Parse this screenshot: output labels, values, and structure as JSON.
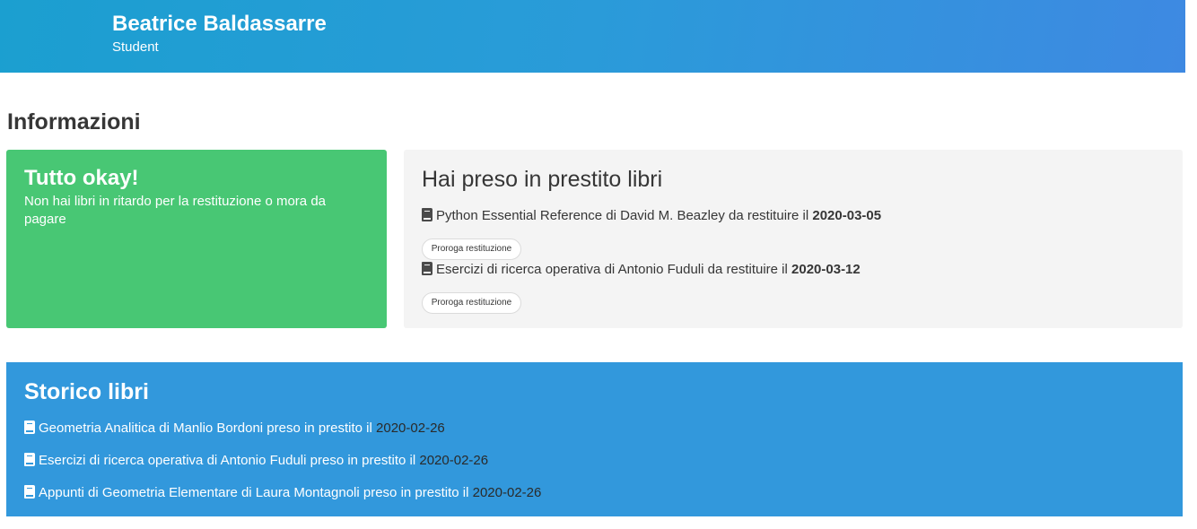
{
  "header": {
    "name": "Beatrice Baldassarre",
    "role": "Student"
  },
  "section_title": "Informazioni",
  "status_card": {
    "title": "Tutto okay!",
    "message": "Non hai libri in ritardo per la restituzione o mora da pagare"
  },
  "loans_card": {
    "title": "Hai preso in prestito libri",
    "items": [
      {
        "icon": "book-icon",
        "text": "Python Essential Reference di David M. Beazley da restituire il ",
        "due": "2020-03-05",
        "button": "Proroga restituzione"
      },
      {
        "icon": "book-icon",
        "text": "Esercizi di ricerca operativa di Antonio Fuduli da restituire il ",
        "due": "2020-03-12",
        "button": "Proroga restituzione"
      }
    ]
  },
  "history_card": {
    "title": "Storico libri",
    "items": [
      {
        "icon": "book-icon",
        "text": "Geometria Analitica di Manlio Bordoni preso in prestito il ",
        "date": "2020-02-26"
      },
      {
        "icon": "book-icon",
        "text": "Esercizi di ricerca operativa di Antonio Fuduli preso in prestito il ",
        "date": "2020-02-26"
      },
      {
        "icon": "book-icon",
        "text": "Appunti di Geometria Elementare di Laura Montagnoli preso in prestito il ",
        "date": "2020-02-26"
      }
    ]
  },
  "colors": {
    "success": "#48c774",
    "info": "#3298dc",
    "light": "#f4f4f4"
  }
}
